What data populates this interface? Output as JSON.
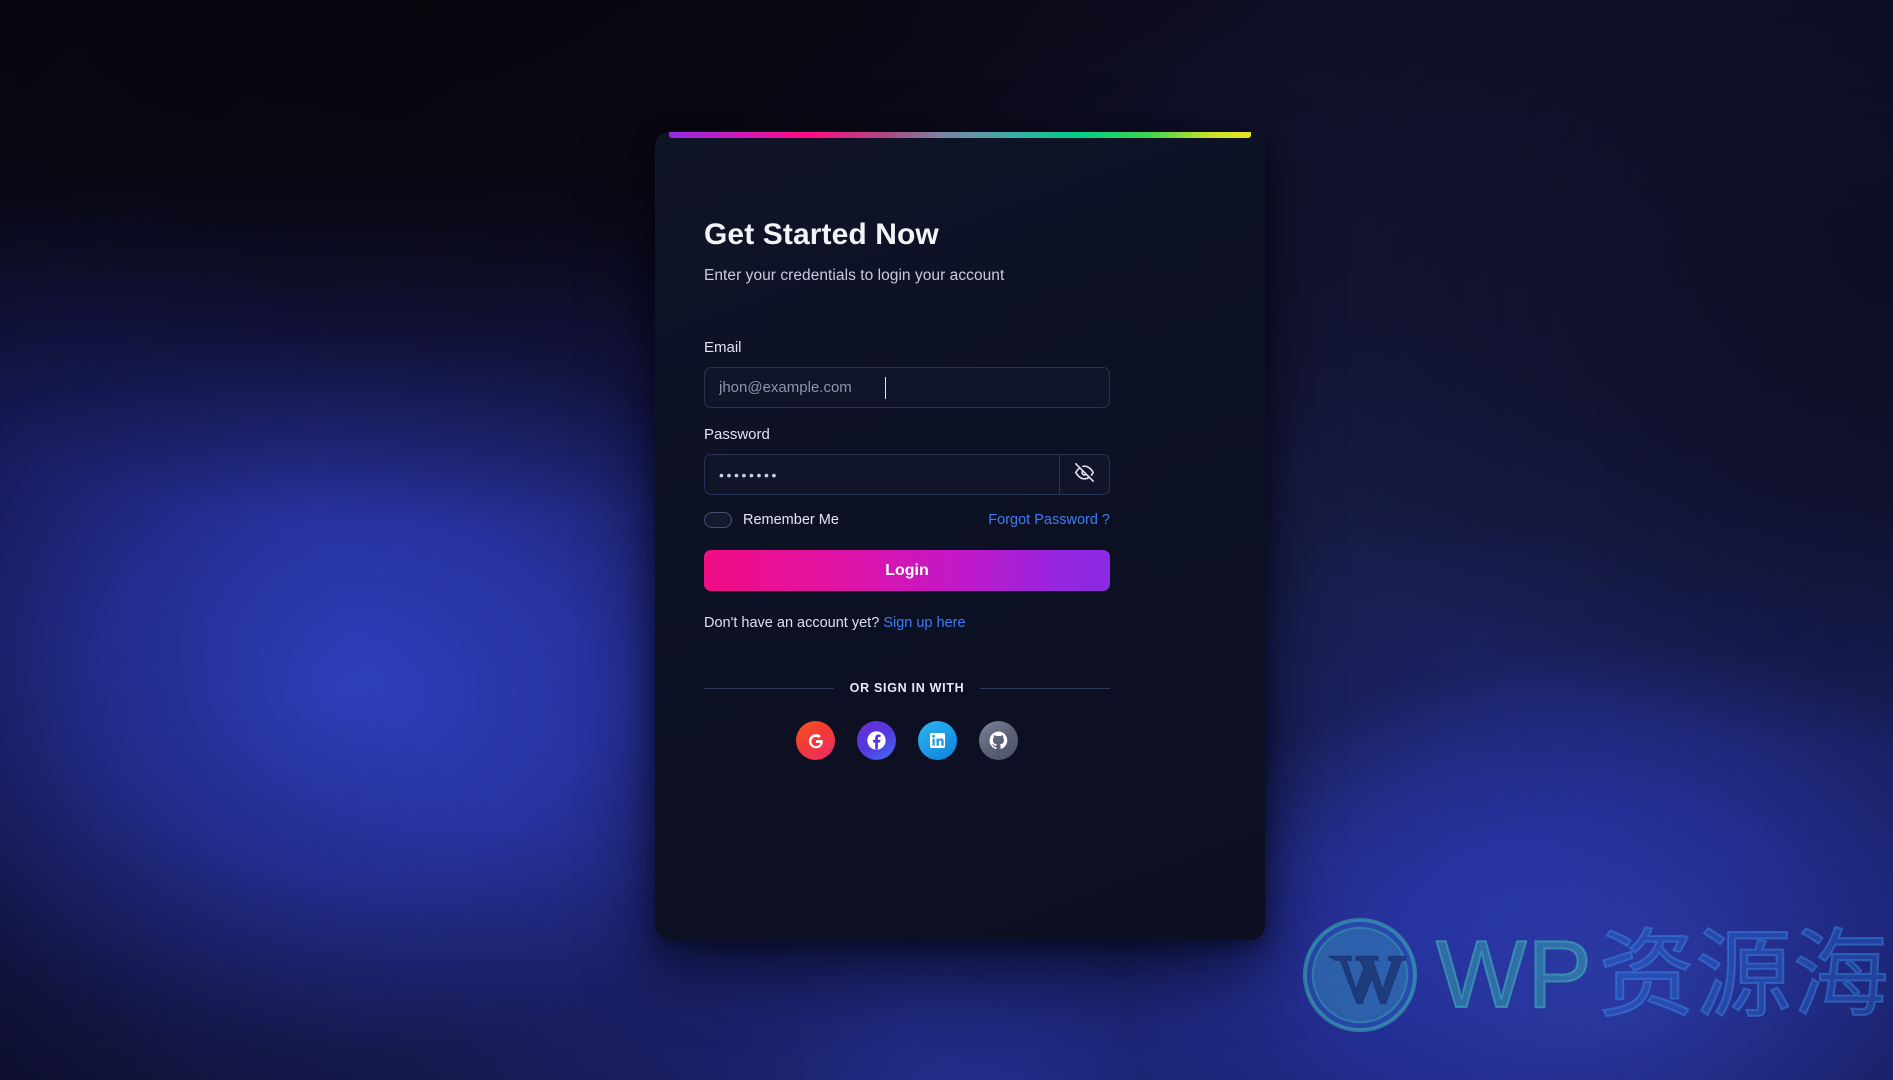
{
  "card": {
    "title": "Get Started Now",
    "subtitle": "Enter your credentials to login your account",
    "accent_gradient": [
      "#8b2fd6",
      "#ee117e",
      "#7d85a0",
      "#10c98c",
      "#c9df3a"
    ]
  },
  "form": {
    "email": {
      "label": "Email",
      "placeholder": "jhon@example.com",
      "value": ""
    },
    "password": {
      "label": "Password",
      "value": "••••••••",
      "toggle_icon": "eye-off-icon"
    },
    "remember": {
      "label": "Remember Me",
      "checked": false
    },
    "forgot_label": "Forgot Password ?",
    "submit_label": "Login",
    "submit_gradient": [
      "#f00d86",
      "#8a2be2"
    ]
  },
  "signup": {
    "prompt": "Don't have an account yet?",
    "link_label": "Sign up here",
    "link_color": "#3f7bf5"
  },
  "divider": {
    "label": "OR SIGN IN WITH"
  },
  "socials": [
    {
      "name": "google",
      "label": "Google",
      "icon": "google-icon",
      "color": "#f43a35"
    },
    {
      "name": "facebook",
      "label": "Facebook",
      "icon": "facebook-icon",
      "color": "#5438df"
    },
    {
      "name": "linkedin",
      "label": "LinkedIn",
      "icon": "linkedin-icon",
      "color": "#1e9ae8"
    },
    {
      "name": "github",
      "label": "GitHub",
      "icon": "github-icon",
      "color": "#5d6379"
    }
  ],
  "watermark": {
    "brand": "WP",
    "brand_cjk": "资源海",
    "logo_icon": "wordpress-logo-icon"
  }
}
